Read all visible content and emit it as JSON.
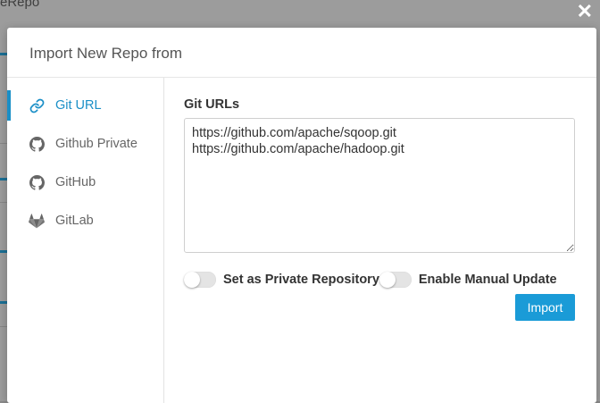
{
  "background": {
    "title_fragment": "eRepo"
  },
  "modal": {
    "title": "Import New Repo from",
    "close_glyph": "✕",
    "nav": [
      {
        "label": "Git URL",
        "icon": "link-icon",
        "active": true
      },
      {
        "label": "Github Private",
        "icon": "github-icon",
        "active": false
      },
      {
        "label": "GitHub",
        "icon": "github-icon",
        "active": false
      },
      {
        "label": "GitLab",
        "icon": "gitlab-icon",
        "active": false
      }
    ],
    "git_urls_label": "Git URLs",
    "git_urls_value": "https://github.com/apache/sqoop.git\nhttps://github.com/apache/hadoop.git",
    "private_toggle_label": "Set as Private Repository",
    "manual_update_toggle_label": "Enable Manual Update",
    "import_button": "Import"
  },
  "colors": {
    "accent": "#1a8fc7",
    "button": "#1a9bd7",
    "overlay": "#9c9c9c"
  }
}
